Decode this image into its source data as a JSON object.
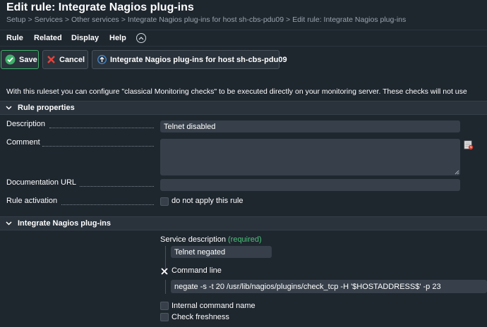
{
  "header": {
    "title": "Edit rule: Integrate Nagios plug-ins",
    "breadcrumb": [
      "Setup",
      "Services",
      "Other services",
      "Integrate Nagios plug-ins for host sh-cbs-pdu09",
      "Edit rule: Integrate Nagios plug-ins"
    ],
    "breadcrumb_separator": ">"
  },
  "menu": {
    "items": [
      "Rule",
      "Related",
      "Display",
      "Help"
    ]
  },
  "toolbar": {
    "save_label": "Save",
    "cancel_label": "Cancel",
    "host_link_label": "Integrate Nagios plug-ins for host sh-cbs-pdu09"
  },
  "intro_text": "With this ruleset you can configure \"classical Monitoring checks\" to be executed directly on your monitoring server. These checks will not use",
  "rule_properties": {
    "title": "Rule properties",
    "description_label": "Description",
    "description_value": "Telnet disabled",
    "comment_label": "Comment",
    "comment_value": "",
    "doc_url_label": "Documentation URL",
    "doc_url_value": "",
    "activation_label": "Rule activation",
    "activation_checkbox_label": "do not apply this rule"
  },
  "nagios": {
    "title": "Integrate Nagios plug-ins",
    "service_description_label": "Service description",
    "required_label": "(required)",
    "service_description_value": "Telnet negated",
    "command_line_label": "Command line",
    "command_line_value": "negate -s -t 20 /usr/lib/nagios/plugins/check_tcp -H '$HOSTADDRESS$' -p 23",
    "internal_command_label": "Internal command name",
    "check_freshness_label": "Check freshness"
  },
  "colors": {
    "background": "#1e262e",
    "section_header": "#2a333c",
    "input": "#37404a",
    "accent_green": "#3fb16a",
    "required_green": "#4ec27c",
    "cancel_red": "#e4433c",
    "link_blue": "#3d8ad6"
  }
}
